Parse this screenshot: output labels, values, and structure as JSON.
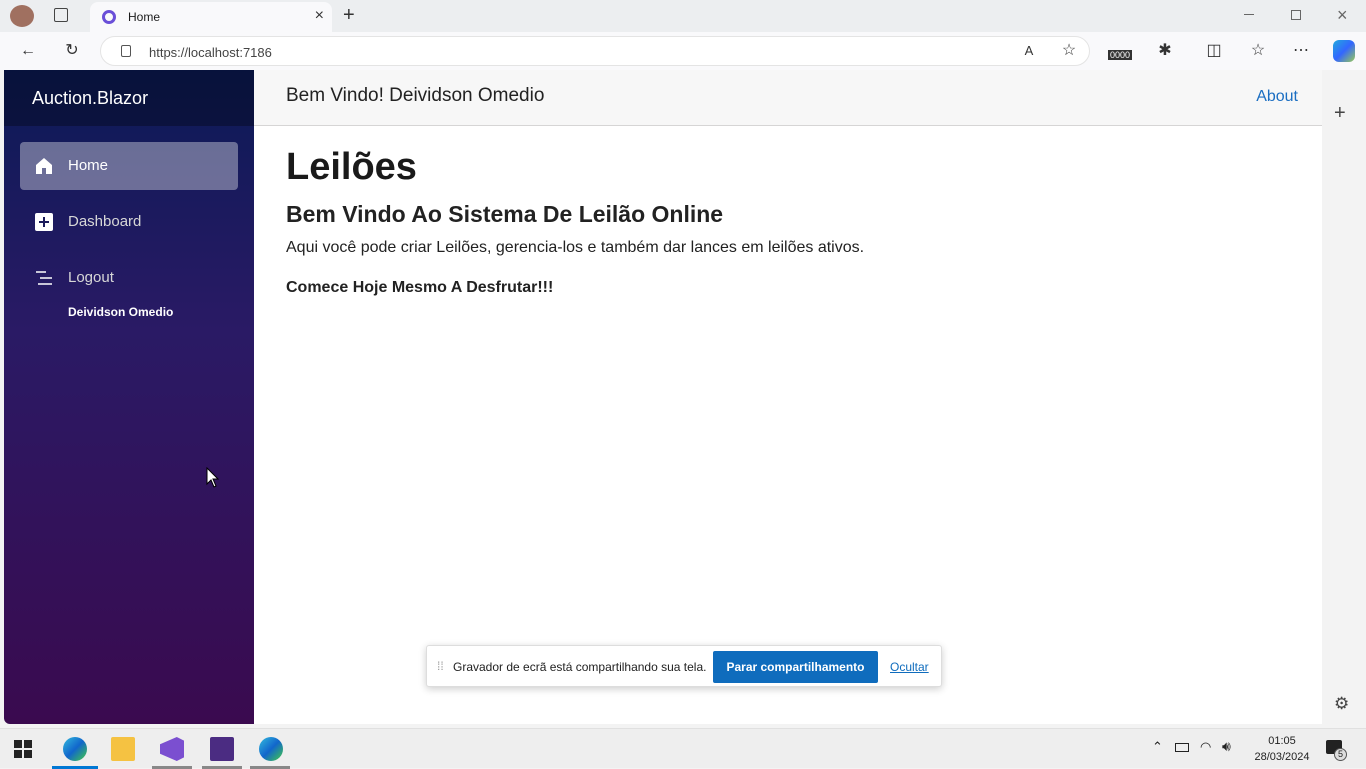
{
  "browser": {
    "tab_title": "Home",
    "url": "https://localhost:7186",
    "icons": [
      "profile-icon",
      "workspaces-icon",
      "back-icon",
      "refresh-icon",
      "lock-icon",
      "read-aloud-icon",
      "favorite-icon",
      "extensions-icon",
      "split-screen-icon",
      "favorites-icon",
      "more-icon",
      "copilot-icon"
    ],
    "counter_badge": "0000"
  },
  "sidebar": {
    "brand": "Auction.Blazor",
    "items": [
      {
        "label": "Home",
        "icon": "home-icon",
        "active": true
      },
      {
        "label": "Dashboard",
        "icon": "plus-square-icon",
        "active": false
      },
      {
        "label": "Logout",
        "icon": "list-icon",
        "active": false
      }
    ],
    "username": "Deividson Omedio"
  },
  "topbar": {
    "welcome": "Bem Vindo! Deividson Omedio",
    "about": "About"
  },
  "main": {
    "title": "Leilões",
    "subtitle": "Bem Vindo Ao Sistema De Leilão Online",
    "description": "Aqui você pode criar Leilões, gerencia-los e também dar lances em leilões ativos.",
    "cta": "Comece Hoje Mesmo A Desfrutar!!!"
  },
  "share_bar": {
    "message": "Gravador de ecrã está compartilhando sua tela.",
    "stop": "Parar compartilhamento",
    "hide": "Ocultar"
  },
  "taskbar": {
    "time": "01:05",
    "date": "28/03/2024",
    "notifications": "5"
  },
  "colors": {
    "accent": "#1b6ec2",
    "sidebar_top": "#0b1a56",
    "sidebar_bottom": "#3a0a4f",
    "share_button": "#0f6cbd"
  }
}
